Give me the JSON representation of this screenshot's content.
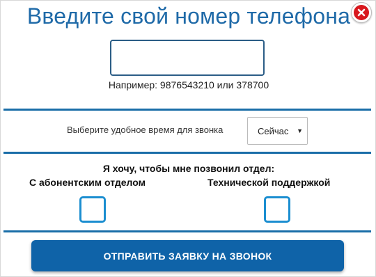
{
  "dialog": {
    "title": "Введите свой номер телефона",
    "close_icon": "close-x-icon"
  },
  "phone": {
    "value": "",
    "hint": "Например: 9876543210 или 378700"
  },
  "time": {
    "label": "Выберите удобное время для звонка",
    "selected": "Сейчас"
  },
  "department": {
    "title": "Я хочу, чтобы мне позвонил отдел:",
    "options": [
      {
        "label": "С абонентским отделом",
        "checked": false
      },
      {
        "label": "Технической поддержкой",
        "checked": false
      }
    ]
  },
  "submit": {
    "label": "ОТПРАВИТЬ ЗАЯВКУ НА ЗВОНОК"
  },
  "colors": {
    "accent": "#1a6ea8",
    "title": "#1f6aa8",
    "button": "#0f63a8",
    "checkbox": "#1b8ed0",
    "close": "#d8181e"
  }
}
